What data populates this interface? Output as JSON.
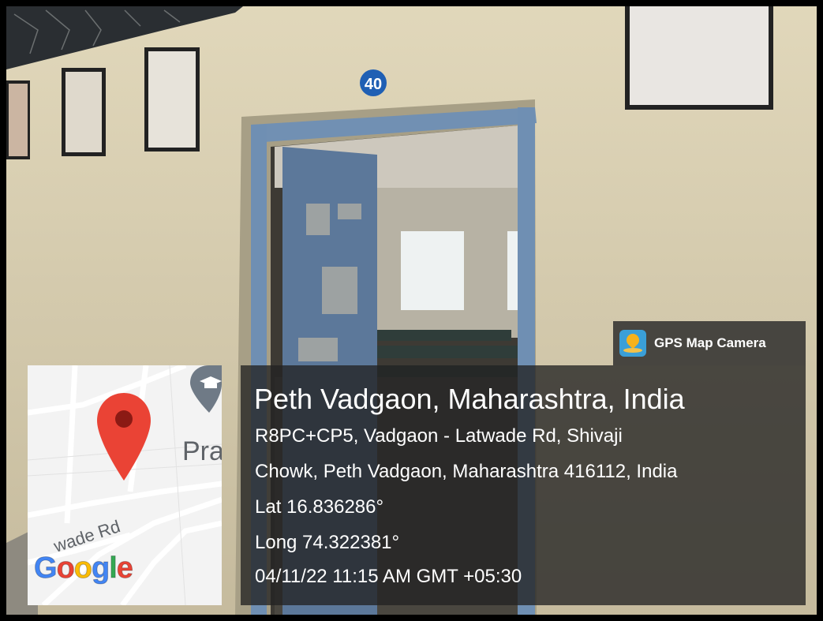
{
  "photo": {
    "room_number": "40"
  },
  "camera_badge": {
    "app_name": "GPS Map Camera",
    "icon": "gps-map-camera-icon"
  },
  "info": {
    "place": "Peth Vadgaon, Maharashtra, India",
    "address_line_1": "R8PC+CP5, Vadgaon - Latwade Rd, Shivaji",
    "address_line_2": "Chowk, Peth Vadgaon, Maharashtra 416112, India",
    "latitude": "Lat 16.836286°",
    "longitude": "Long 74.322381°",
    "datetime": "04/11/22 11:15 AM GMT +05:30"
  },
  "map": {
    "place_label": "Pra",
    "road_label": "wade Rd",
    "brand": "Google",
    "pin_icon": "location-pin-icon",
    "school_icon": "school-marker-icon",
    "colors": {
      "pin": "#ea4335",
      "google_blue": "#4285f4",
      "google_red": "#ea4335",
      "google_yellow": "#fbbc05",
      "google_green": "#34a853"
    }
  }
}
